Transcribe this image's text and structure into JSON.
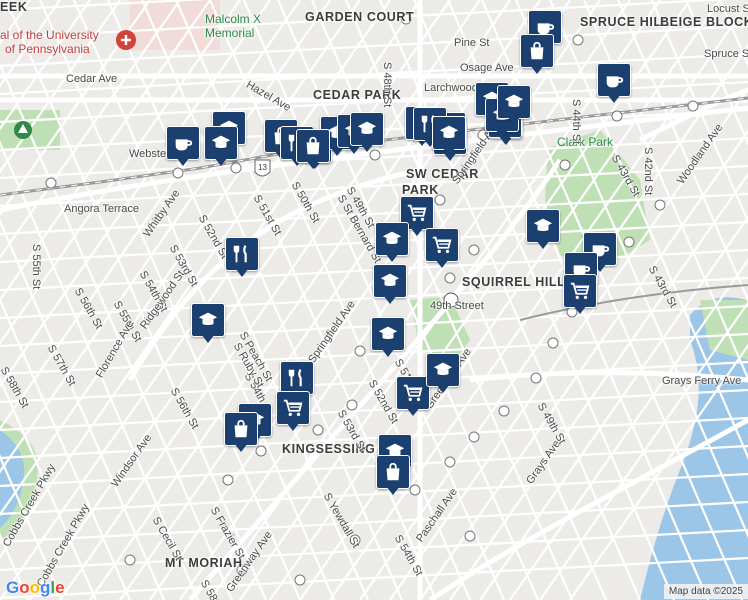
{
  "map": {
    "attribution": "Map data ©2025",
    "google_logo": [
      "G",
      "o",
      "o",
      "g",
      "l",
      "e"
    ],
    "google_colors": [
      "#4285F4",
      "#EA4335",
      "#FBBC05",
      "#4285F4",
      "#34A853",
      "#EA4335"
    ],
    "colors": {
      "marker": "#1b3f6e",
      "water": "#9cc6e8",
      "park": "#bfe0b5",
      "road": "#ffffff",
      "rail": "#9a9a9a",
      "land": "#ecebe8"
    }
  },
  "area_labels": [
    {
      "text": "GARDEN COURT",
      "style": "dark"
    },
    {
      "text": "SPRUCE HILL",
      "style": "dark"
    },
    {
      "text": "BEIGE BLOCK",
      "style": "dark"
    },
    {
      "text": "CEDAR PARK",
      "style": "dark"
    },
    {
      "text": "SW CEDAR",
      "style": "dark"
    },
    {
      "text": "PARK",
      "style": "dark"
    },
    {
      "text": "SQUIRREL HILL",
      "style": "dark"
    },
    {
      "text": "KINGSESSING",
      "style": "dark"
    },
    {
      "text": "MT MORIAH",
      "style": "dark"
    },
    {
      "text": "Malcolm X",
      "style": "green"
    },
    {
      "text": "Memorial",
      "style": "green"
    },
    {
      "text": "Clark Park",
      "style": "green"
    },
    {
      "text": "al of the University",
      "style": "red"
    },
    {
      "text": "of Pennsylvania",
      "style": "red"
    },
    {
      "text": "EEK",
      "style": "dark"
    }
  ],
  "street_labels": [
    "Pine St",
    "Osage Ave",
    "Larchwood Ave",
    "Hazel Ave",
    "Cedar Ave",
    "Webster St",
    "Angora Terrace",
    "Whitby Ave",
    "S 52nd St",
    "S 51st St",
    "S 50th St",
    "S 49th St",
    "S 48th St",
    "S 53rd St",
    "S 54th St",
    "S 55th St",
    "S 56th St",
    "S 57th St",
    "S 58th St",
    "S 54th St",
    "S 55th St",
    "S 56th St",
    "Ridgewood St",
    "Florence Ave",
    "Windsor Ave",
    "S Peach St",
    "S Ruby St",
    "Springfield Ave",
    "S 52nd St",
    "S 53rd St",
    "S 54th St",
    "S Yewdall St",
    "S Frazier St",
    "S Cecil St",
    "Greenway Ave",
    "Paschall Ave",
    "Grays Ave",
    "S 49th St",
    "Grays Ferry Ave",
    "Woodland Ave",
    "S 42nd St",
    "S 43rd St",
    "S 43rd St",
    "S 44th St",
    "Spruce St",
    "Locust St",
    "Springfield Ave",
    "Cobbs Creek Pkwy",
    "Cobbs Creek Pkwy",
    "Greenway Ave",
    "S 51st St",
    "Chester Ave",
    "Baltimore Ave",
    "Cedar Ave",
    "S 54th St",
    "Osage Ave",
    "Baltimore Ave",
    "S St Bernard St",
    "S 58th St",
    "49th Street",
    "Webster St",
    "Larchwood Ave"
  ],
  "route_shield": "13",
  "markers": [
    {
      "type": "coffee"
    },
    {
      "type": "shopping"
    },
    {
      "type": "coffee"
    },
    {
      "type": "shopping"
    },
    {
      "type": "school"
    },
    {
      "type": "coffee"
    },
    {
      "type": "school"
    },
    {
      "type": "restaurant"
    },
    {
      "type": "shopping"
    },
    {
      "type": "school"
    },
    {
      "type": "school"
    },
    {
      "type": "school"
    },
    {
      "type": "shopping"
    },
    {
      "type": "school"
    },
    {
      "type": "school"
    },
    {
      "type": "restaurant"
    },
    {
      "type": "school"
    },
    {
      "type": "cart"
    },
    {
      "type": "school"
    },
    {
      "type": "cart"
    },
    {
      "type": "school"
    },
    {
      "type": "school"
    },
    {
      "type": "cart"
    },
    {
      "type": "cart"
    },
    {
      "type": "restaurant"
    },
    {
      "type": "school"
    },
    {
      "type": "school"
    },
    {
      "type": "school"
    },
    {
      "type": "school"
    },
    {
      "type": "cart"
    },
    {
      "type": "school"
    },
    {
      "type": "coffee"
    },
    {
      "type": "coffee"
    },
    {
      "type": "cart"
    },
    {
      "type": "restaurant"
    },
    {
      "type": "cart"
    },
    {
      "type": "school"
    },
    {
      "type": "shopping"
    },
    {
      "type": "school"
    },
    {
      "type": "shopping"
    },
    {
      "type": "school"
    },
    {
      "type": "school"
    }
  ]
}
